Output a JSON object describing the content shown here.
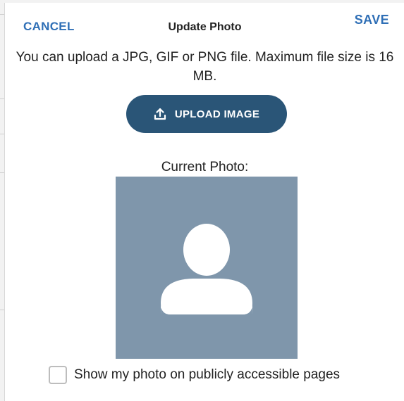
{
  "header": {
    "cancel_label": "CANCEL",
    "title": "Update Photo",
    "save_label": "SAVE"
  },
  "info": {
    "text": "You can upload a JPG, GIF or PNG file. Maximum file size is 16 MB."
  },
  "upload": {
    "label": "UPLOAD IMAGE",
    "icon": "upload-icon"
  },
  "current_photo": {
    "label": "Current Photo:",
    "placeholder_icon": "person-silhouette-icon"
  },
  "public_option": {
    "label": "Show my photo on publicly accessible pages",
    "checked": false
  },
  "colors": {
    "accent": "#2f6fb6",
    "button": "#2a5577",
    "photo_bg": "#7f96ab"
  }
}
